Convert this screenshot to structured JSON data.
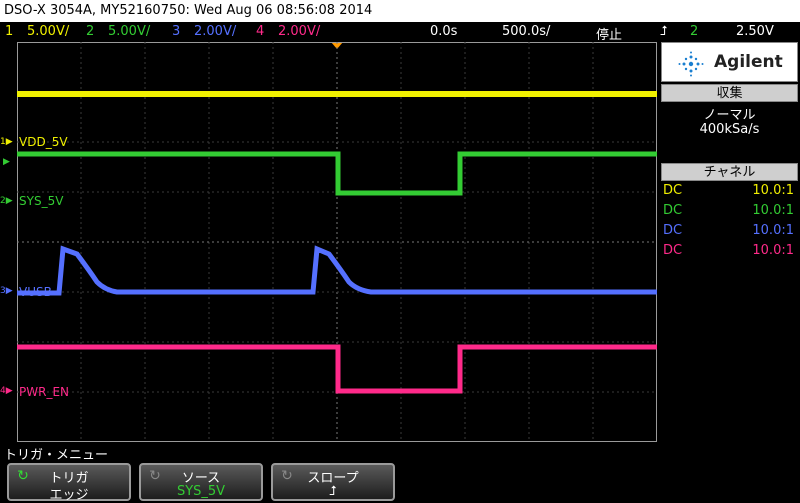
{
  "title": "DSO-X 3054A, MY52160750: Wed Aug 06 08:56:08 2014",
  "channels": [
    {
      "num": "1",
      "scale": "5.00V/",
      "color": "#f0f000",
      "label": "VDD_5V"
    },
    {
      "num": "2",
      "scale": "5.00V/",
      "color": "#33cc33",
      "label": "SYS_5V"
    },
    {
      "num": "3",
      "scale": "2.00V/",
      "color": "#5570ff",
      "label": "VUSB"
    },
    {
      "num": "4",
      "scale": "2.00V/",
      "color": "#ff2a8a",
      "label": "PWR_EN"
    }
  ],
  "timebase": {
    "delay": "0.0s",
    "scale": "500.0s/",
    "status": "停止"
  },
  "trigger": {
    "source_num": "2",
    "level": "2.50V",
    "icon": "trigger-slope-icon"
  },
  "brand": "Agilent",
  "acquisition": {
    "header": "収集",
    "mode": "ノーマル",
    "rate": "400kSa/s"
  },
  "channel_panel": {
    "header": "チャネル",
    "rows": [
      {
        "coupling": "DC",
        "probe": "10.0:1",
        "color": "#f0f000"
      },
      {
        "coupling": "DC",
        "probe": "10.0:1",
        "color": "#33cc33"
      },
      {
        "coupling": "DC",
        "probe": "10.0:1",
        "color": "#5570ff"
      },
      {
        "coupling": "DC",
        "probe": "10.0:1",
        "color": "#ff2a8a"
      }
    ]
  },
  "menu": {
    "title": "トリガ・メニュー",
    "softkeys": [
      {
        "top": "トリガ",
        "bottom": "エッジ",
        "bottom_color": "#ffffff",
        "icon": "rotate-knob-icon"
      },
      {
        "top": "ソース",
        "bottom": "SYS_5V",
        "bottom_color": "#33cc33",
        "icon": "rotate-knob-icon"
      },
      {
        "top": "スロープ",
        "bottom": "⮥",
        "bottom_color": "#ffffff",
        "icon": "rotate-knob-icon"
      }
    ]
  }
}
